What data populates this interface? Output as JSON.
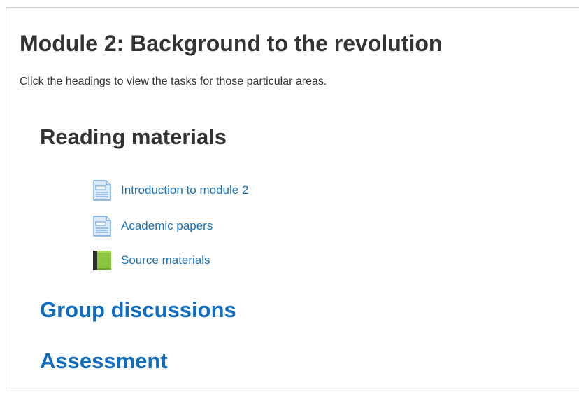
{
  "module": {
    "title": "Module 2: Background to the revolution",
    "intro": "Click the headings to view the tasks for those particular areas."
  },
  "sections": [
    {
      "title": "Reading materials",
      "expanded": true,
      "activities": [
        {
          "label": "Introduction to module 2",
          "icon": "page-icon"
        },
        {
          "label": "Academic papers",
          "icon": "page-icon"
        },
        {
          "label": "Source materials",
          "icon": "book-icon"
        }
      ]
    },
    {
      "title": "Group discussions",
      "expanded": false
    },
    {
      "title": "Assessment",
      "expanded": false
    }
  ],
  "colors": {
    "heading_text": "#333333",
    "link": "#0f6cbf",
    "activity_link": "#1a71b8",
    "page_icon_blue": "#5b9bd5",
    "book_icon_green": "#8cc63f"
  }
}
